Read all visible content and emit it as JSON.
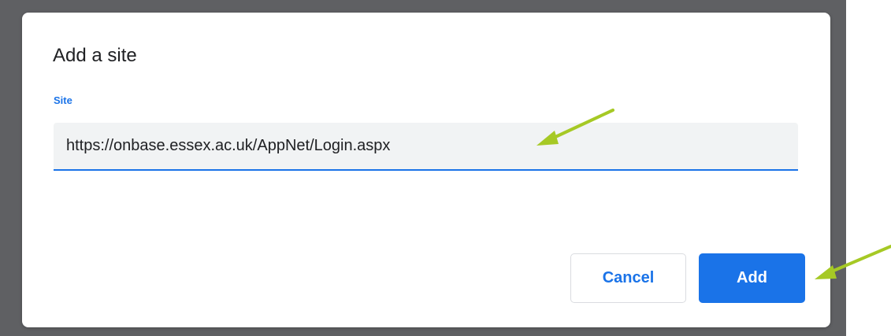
{
  "dialog": {
    "title": "Add a site",
    "field_label": "Site",
    "site_value": "https://onbase.essex.ac.uk/AppNet/Login.aspx",
    "cancel_label": "Cancel",
    "add_label": "Add"
  },
  "colors": {
    "accent": "#1a73e8",
    "backdrop": "#5f6063",
    "annotation_arrow": "#a6c925"
  }
}
